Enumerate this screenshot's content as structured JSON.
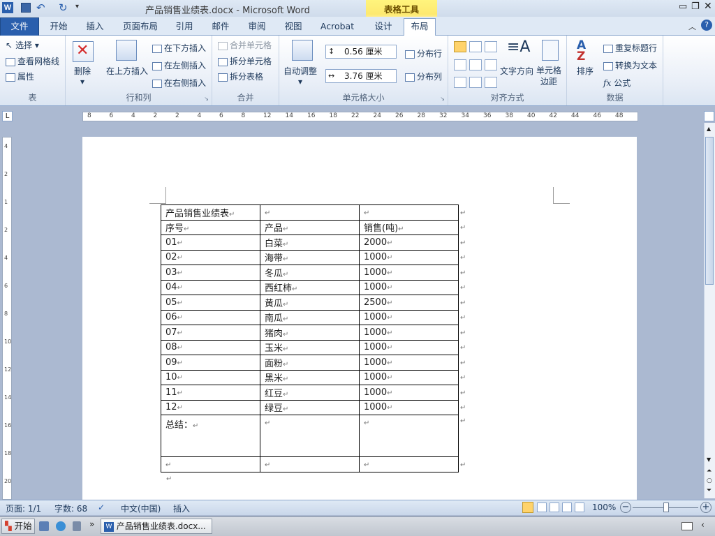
{
  "titlebar": {
    "title": "产品销售业绩表.docx - Microsoft Word",
    "context_group": "表格工具",
    "quick_access": [
      "save-icon",
      "undo-icon",
      "redo-icon",
      "customize-icon"
    ]
  },
  "tabs": [
    "文件",
    "开始",
    "插入",
    "页面布局",
    "引用",
    "邮件",
    "审阅",
    "视图",
    "Acrobat",
    "设计",
    "布局"
  ],
  "ribbon": {
    "table": {
      "label": "表",
      "select": "选择",
      "gridlines": "查看网格线",
      "properties": "属性"
    },
    "rows_cols": {
      "label": "行和列",
      "delete": "删除",
      "insert_above": "在上方插入",
      "insert_below": "在下方插入",
      "insert_left": "在左侧插入",
      "insert_right": "在右侧插入"
    },
    "merge": {
      "label": "合并",
      "merge_cells": "合并单元格",
      "split_cells": "拆分单元格",
      "split_table": "拆分表格"
    },
    "cell_size": {
      "label": "单元格大小",
      "autofit": "自动调整",
      "height": "0.56 厘米",
      "width": "3.76 厘米",
      "distribute_rows": "分布行",
      "distribute_cols": "分布列"
    },
    "alignment": {
      "label": "对齐方式",
      "text_direction": "文字方向",
      "cell_margins_1": "单元格",
      "cell_margins_2": "边距"
    },
    "data": {
      "label": "数据",
      "sort": "排序",
      "repeat_header": "重复标题行",
      "convert_text": "转换为文本",
      "formula": "公式"
    }
  },
  "ruler": {
    "h_ticks": [
      "8",
      "6",
      "4",
      "2",
      "2",
      "4",
      "6",
      "8",
      "12",
      "14",
      "16",
      "18",
      "22",
      "24",
      "26",
      "28",
      "32",
      "34",
      "36",
      "38",
      "40",
      "42",
      "44",
      "46",
      "48"
    ],
    "v_ticks": [
      "4",
      "2",
      "1",
      "2",
      "4",
      "6",
      "8",
      "10",
      "12",
      "14",
      "16",
      "18",
      "20"
    ]
  },
  "table": {
    "rows": [
      [
        "产品销售业绩表",
        "",
        ""
      ],
      [
        "序号",
        "产品",
        "销售(吨)"
      ],
      [
        "01",
        "白菜",
        "2000"
      ],
      [
        "02",
        "海带",
        "1000"
      ],
      [
        "03",
        "冬瓜",
        "1000"
      ],
      [
        "04",
        "西红柿",
        "1000"
      ],
      [
        "05",
        "黄瓜",
        "2500"
      ],
      [
        "06",
        "南瓜",
        "1000"
      ],
      [
        "07",
        "猪肉",
        "1000"
      ],
      [
        "08",
        "玉米",
        "1000"
      ],
      [
        "09",
        "面粉",
        "1000"
      ],
      [
        "10",
        "黑米",
        "1000"
      ],
      [
        "11",
        "红豆",
        "1000"
      ],
      [
        "12",
        "绿豆",
        "1000"
      ],
      [
        "总结：",
        "",
        ""
      ],
      [
        "",
        "",
        ""
      ]
    ],
    "para_mark": "↵"
  },
  "status": {
    "page": "页面: 1/1",
    "words": "字数: 68",
    "lang": "中文(中国)",
    "mode": "插入",
    "zoom": "100%"
  },
  "taskbar": {
    "start": "开始",
    "task": "产品销售业绩表.docx..."
  }
}
